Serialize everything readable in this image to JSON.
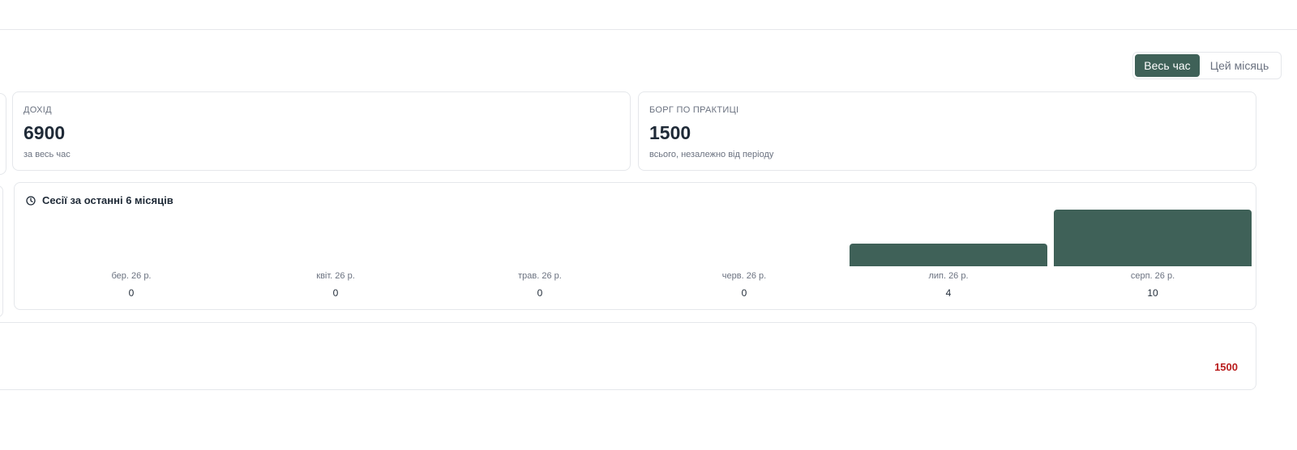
{
  "period_toggle": {
    "all_time": "Весь час",
    "this_month": "Цей місяць"
  },
  "income": {
    "label": "ДОХІД",
    "value": "6900",
    "sub": "за весь час"
  },
  "debt": {
    "label": "БОРГ ПО ПРАКТИЦІ",
    "value": "1500",
    "sub": "всього, незалежно від періоду"
  },
  "sessions_chart": {
    "title": "Сесії за останні 6 місяців",
    "icon": "clock-icon"
  },
  "chart_data": {
    "type": "bar",
    "title": "Сесії за останні 6 місяців",
    "categories": [
      "бер. 26 р.",
      "квіт. 26 р.",
      "трав. 26 р.",
      "черв. 26 р.",
      "лип. 26 р.",
      "серп. 26 р."
    ],
    "values": [
      0,
      0,
      0,
      0,
      4,
      10
    ],
    "ylim": [
      0,
      10
    ],
    "grid": false,
    "bar_color": "#3f6158"
  },
  "debt_row": {
    "amount": "1500",
    "amount_color": "#b91c1c"
  },
  "colors": {
    "accent": "#3f6158",
    "border": "#e5e7eb",
    "muted_text": "#6b7280"
  }
}
